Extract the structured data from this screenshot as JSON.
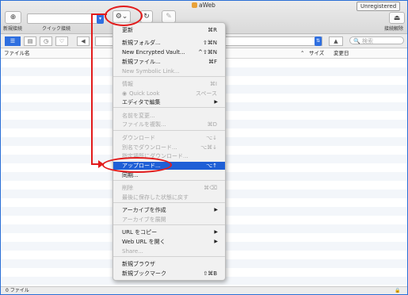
{
  "window": {
    "title": "aWeb",
    "badge": "Unregistered"
  },
  "toolbar": {
    "new_connection_label": "新規接続",
    "quick_connect_label": "クイック接続",
    "disconnect_label": "接続解除",
    "action_button_icon": "gear-icon"
  },
  "bar2": {
    "search_placeholder": "検索"
  },
  "table": {
    "col_name": "ファイル名",
    "col_size": "サイズ",
    "col_modified": "変更日",
    "row_count": 0
  },
  "status": {
    "text": "0 ファイル"
  },
  "menu": {
    "items": [
      {
        "label": "更新",
        "shortcut": "⌘R",
        "disabled": false
      },
      {
        "label": "新規フォルダ...",
        "shortcut": "⇧⌘N",
        "disabled": false
      },
      {
        "label": "New Encrypted Vault...",
        "shortcut": "^⇧⌘N",
        "disabled": false
      },
      {
        "label": "新規ファイル...",
        "shortcut": "⌘F",
        "disabled": false
      },
      {
        "label": "New Symbolic Link...",
        "shortcut": "",
        "disabled": true
      },
      {
        "label": "情報",
        "shortcut": "⌘I",
        "disabled": true
      },
      {
        "label": "Quick Look",
        "shortcut": "スペース",
        "disabled": true
      },
      {
        "label": "エディタで編集",
        "shortcut": "",
        "submenu": true,
        "disabled": false
      },
      {
        "label": "名前を変更...",
        "shortcut": "",
        "disabled": true
      },
      {
        "label": "ファイルを複製...",
        "shortcut": "⌘D",
        "disabled": true
      },
      {
        "label": "ダウンロード",
        "shortcut": "⌥↓",
        "disabled": true
      },
      {
        "label": "別名でダウンロード...",
        "shortcut": "⌥⌘↓",
        "disabled": true
      },
      {
        "label": "指定場所にダウンロード...",
        "shortcut": "",
        "disabled": true
      },
      {
        "label": "アップロード...",
        "shortcut": "⌥↑",
        "disabled": false,
        "highlighted": true
      },
      {
        "label": "同期...",
        "shortcut": "",
        "disabled": false
      },
      {
        "label": "削除",
        "shortcut": "⌘⌫",
        "disabled": true
      },
      {
        "label": "最後に保存した状態に戻す",
        "shortcut": "",
        "disabled": true
      },
      {
        "label": "アーカイブを作成",
        "shortcut": "",
        "submenu": true,
        "disabled": false
      },
      {
        "label": "アーカイブを展開",
        "shortcut": "",
        "disabled": true
      },
      {
        "label": "URL をコピー",
        "shortcut": "",
        "submenu": true,
        "disabled": false
      },
      {
        "label": "Web URL を開く",
        "shortcut": "",
        "submenu": true,
        "disabled": false
      },
      {
        "label": "Share...",
        "shortcut": "",
        "disabled": true
      },
      {
        "label": "新規ブラウザ",
        "shortcut": "",
        "disabled": false
      },
      {
        "label": "新規ブックマーク",
        "shortcut": "⇧⌘B",
        "disabled": false
      }
    ]
  },
  "colors": {
    "highlight": "#1f5fd6",
    "annotation": "#e21b1b",
    "accent": "#2f6fe0"
  }
}
